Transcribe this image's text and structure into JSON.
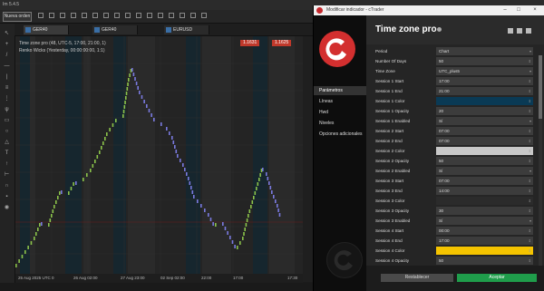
{
  "app": {
    "title": "Im 5.4.5"
  },
  "toolbar": {
    "new_order": "Nueva orden"
  },
  "tabs": [
    {
      "label": "GER40"
    },
    {
      "label": "GER40"
    },
    {
      "label": "EURUSD"
    }
  ],
  "chart": {
    "title": "Time zone pro (48, UTC-5, 17:00, 21:00, 1)",
    "subtitle": "Renko Wicks (Yesterday, 00:00:00:00, 1:1)",
    "price_buy": "1.1631",
    "price_sell": "1.1625",
    "price_buy_color": "#c0392b",
    "price_sell_color": "#c0392b",
    "x_labels": [
      "25 Aug 2025 UTC 0",
      "26 Aug 02:00",
      "27 Aug 23:00",
      "02 Sep 02:00",
      "22:00",
      "17:00",
      "17:30"
    ],
    "candle_colors": {
      "bull": "#8bc34a",
      "bear": "#7a7ae0"
    },
    "session_colors": {
      "s1": "#16262e",
      "s2": "#2a2a2a"
    }
  },
  "dialog": {
    "title": "Modificar indicador - cTrader",
    "heading": "Time zone pro",
    "nav": [
      "Parámetros",
      "Líneas",
      "Hwd",
      "Niveles",
      "Opciones adicionales"
    ],
    "active_nav": "Parámetros",
    "rows": [
      {
        "label": "Period",
        "value": "Chart",
        "dropdown": true
      },
      {
        "label": "Number Of Days",
        "value": "50",
        "dropdown": false
      },
      {
        "label": "Time Zone",
        "value": "UTC_plus5",
        "dropdown": true
      },
      {
        "label": "Session 1 Start",
        "value": "17:00",
        "dropdown": false
      },
      {
        "label": "Session 1 End",
        "value": "21:00",
        "dropdown": false
      },
      {
        "label": "Session 1 Color",
        "value": "",
        "color": "#0a3a55",
        "dropdown": false
      },
      {
        "label": "Session 1 Opacity",
        "value": "20",
        "dropdown": false
      },
      {
        "label": "Session 1 Enabled",
        "value": "Sí",
        "dropdown": true
      },
      {
        "label": "Session 2 Start",
        "value": "07:00",
        "dropdown": false
      },
      {
        "label": "Session 2 End",
        "value": "07:00",
        "dropdown": false
      },
      {
        "label": "Session 2 Color",
        "value": "",
        "color": "#c8c8c8",
        "dropdown": false
      },
      {
        "label": "Session 2 Opacity",
        "value": "50",
        "dropdown": false
      },
      {
        "label": "Session 2 Enabled",
        "value": "Sí",
        "dropdown": true
      },
      {
        "label": "Session 3 Start",
        "value": "07:00",
        "dropdown": false
      },
      {
        "label": "Session 3 End",
        "value": "14:00",
        "dropdown": false
      },
      {
        "label": "Session 3 Color",
        "value": "",
        "color": "#2b2b2b",
        "dropdown": false
      },
      {
        "label": "Session 3 Opacity",
        "value": "30",
        "dropdown": false
      },
      {
        "label": "Session 3 Enabled",
        "value": "Sí",
        "dropdown": true
      },
      {
        "label": "Session 4 Start",
        "value": "00:00",
        "dropdown": false
      },
      {
        "label": "Session 4 End",
        "value": "17:00",
        "dropdown": false
      },
      {
        "label": "Session 4 Color",
        "value": "",
        "color": "#f5c400",
        "dropdown": false
      },
      {
        "label": "Session 4 Opacity",
        "value": "50",
        "dropdown": false
      }
    ],
    "btn_restore": "Restablecer",
    "btn_accept": "Aceptar"
  }
}
